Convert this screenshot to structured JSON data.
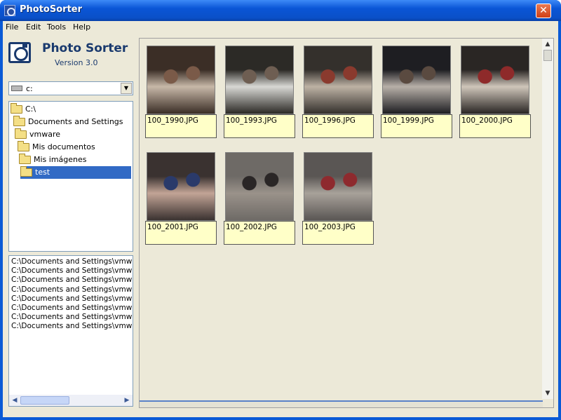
{
  "window": {
    "title": "PhotoSorter",
    "close_glyph": "✕"
  },
  "menu": [
    "File",
    "Edit",
    "Tools",
    "Help"
  ],
  "app": {
    "name": "Photo Sorter",
    "version": "Version 3.0"
  },
  "drive": {
    "value": "c:",
    "drop_glyph": "▼"
  },
  "tree": [
    {
      "label": "C:\\",
      "selected": false
    },
    {
      "label": "Documents and Settings",
      "selected": false
    },
    {
      "label": "vmware",
      "selected": false
    },
    {
      "label": "Mis documentos",
      "selected": false
    },
    {
      "label": "Mis imágenes",
      "selected": false
    },
    {
      "label": "test",
      "selected": true
    }
  ],
  "paths": [
    "C:\\Documents and Settings\\vmwar",
    "C:\\Documents and Settings\\vmwar",
    "C:\\Documents and Settings\\vmwar",
    "C:\\Documents and Settings\\vmwar",
    "C:\\Documents and Settings\\vmwar",
    "C:\\Documents and Settings\\vmwar",
    "C:\\Documents and Settings\\vmwar",
    "C:\\Documents and Settings\\vmwar"
  ],
  "thumbnails": [
    {
      "name": "100_1990.JPG",
      "palette": [
        "#3b2e26",
        "#c7b8a8",
        "#7a5a48"
      ]
    },
    {
      "name": "100_1993.JPG",
      "palette": [
        "#2c2a26",
        "#d8d8d4",
        "#6e5e52"
      ]
    },
    {
      "name": "100_1996.JPG",
      "palette": [
        "#34302c",
        "#bdb2a4",
        "#8a3a2e"
      ]
    },
    {
      "name": "100_1999.JPG",
      "palette": [
        "#1e1e22",
        "#b8b0a8",
        "#5a4a40"
      ]
    },
    {
      "name": "100_2000.JPG",
      "palette": [
        "#2a2624",
        "#cfc6ba",
        "#8e2a2a"
      ]
    },
    {
      "name": "100_2001.JPG",
      "palette": [
        "#3a3230",
        "#c2a496",
        "#2a3a6a"
      ]
    },
    {
      "name": "100_2002.JPG",
      "palette": [
        "#6e6a66",
        "#9a928a",
        "#2a2626"
      ]
    },
    {
      "name": "100_2003.JPG",
      "palette": [
        "#5a5654",
        "#a8a29a",
        "#8e2a2e"
      ]
    }
  ],
  "scroll": {
    "left": "◀",
    "right": "▶",
    "up": "▲",
    "down": "▼"
  },
  "colors": {
    "titlebar": "#0a55d6",
    "selection": "#316ac5",
    "caption_bg": "#ffffc8"
  }
}
